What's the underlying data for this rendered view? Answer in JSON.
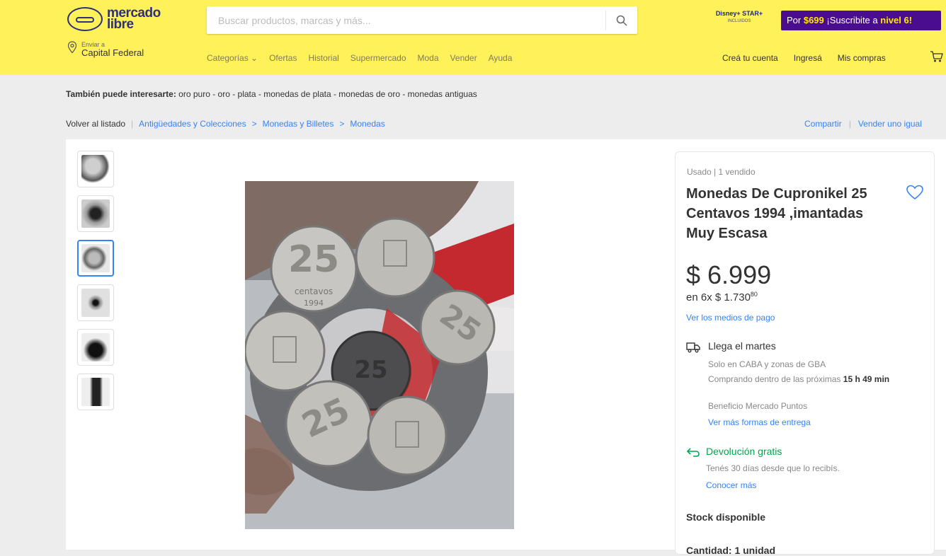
{
  "header": {
    "logo_line1": "mercado",
    "logo_line2": "libre",
    "search_placeholder": "Buscar productos, marcas y más...",
    "disney_text": "Disney+ STAR+",
    "disney_sub": "INCLUIDOS",
    "promo_prefix": "Por ",
    "promo_price": "$699",
    "promo_mid": " ¡Suscribite a ",
    "promo_level": "nivel 6!",
    "location_small": "Enviar a",
    "location_big": "Capital Federal",
    "nav": [
      "Categorías ⌄",
      "Ofertas",
      "Historial",
      "Supermercado",
      "Moda",
      "Vender",
      "Ayuda"
    ],
    "right_nav": [
      "Creá tu cuenta",
      "Ingresá",
      "Mis compras"
    ]
  },
  "interest": {
    "label": "También puede interesarte:",
    "terms": "oro puro - oro - plata - monedas de plata - monedas de oro - monedas antiguas"
  },
  "breadcrumb": {
    "back": "Volver al listado",
    "sep": "|",
    "items": [
      "Antigüedades y Colecciones",
      ">",
      "Monedas y Billetes",
      ">",
      "Monedas"
    ]
  },
  "share": {
    "share": "Compartir",
    "sep": "|",
    "sell": "Vender uno igual"
  },
  "product": {
    "condition": "Usado  |  1 vendido",
    "title": "Monedas De Cupronikel 25 Centavos 1994 ,imantadas Muy Escasa",
    "price": "$ 6.999",
    "installments": "en 6x $ 1.730",
    "installments_cents": "80",
    "payment_link": "Ver los medios de pago",
    "shipping_title": "Llega el martes",
    "shipping_sub": "Solo en CABA y zonas de GBA",
    "shipping_time_prefix": "Comprando dentro de las próximas ",
    "shipping_time_value": "15 h 49 min",
    "shipping_bonus": "Beneficio Mercado Puntos",
    "shipping_more": "Ver más formas de entrega",
    "return_title": "Devolución gratis",
    "return_sub": "Tenés 30 días desde que lo recibís.",
    "return_more": "Conocer más",
    "stock": "Stock disponible",
    "quantity": "Cantidad: 1 unidad"
  },
  "coins": {
    "value": "25",
    "unit": "centavos",
    "year": "1994"
  },
  "colors": {
    "header_bg": "#fff159",
    "link": "#3483fa",
    "green": "#00a650",
    "promo_bg": "#4a0d8f"
  }
}
